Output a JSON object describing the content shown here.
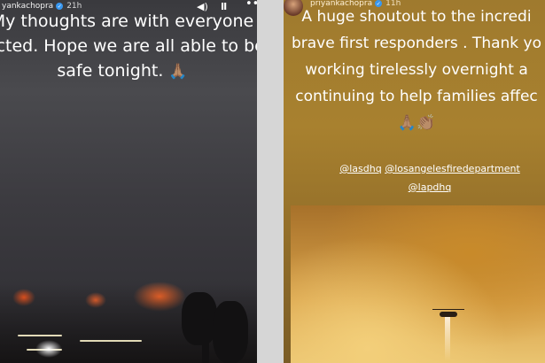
{
  "left_story": {
    "username": "yankachopra",
    "time": "21h",
    "caption_lines": [
      "My thoughts are with everyone",
      "fected. Hope we are all able to be",
      "safe tonight."
    ],
    "emoji": "🙏🏽"
  },
  "right_story": {
    "username": "priyankachopra",
    "time": "11h",
    "caption_lines": [
      "A huge shoutout to the incredi",
      "brave first responders . Thank yo",
      "working tirelessly overnight a",
      "continuing to help families affec"
    ],
    "emojis": "🙏🏽👏🏽",
    "mentions": [
      "@lasdhq",
      "@losangelesfiredepartment",
      "@lapdhq"
    ]
  },
  "controls": {
    "sound_icon": "◀)",
    "pause_icon": "II",
    "more_icon": "•••"
  },
  "colors": {
    "verified": "#3897f0",
    "left_bg": "#3d3c41",
    "right_bg": "#a37b2d"
  }
}
